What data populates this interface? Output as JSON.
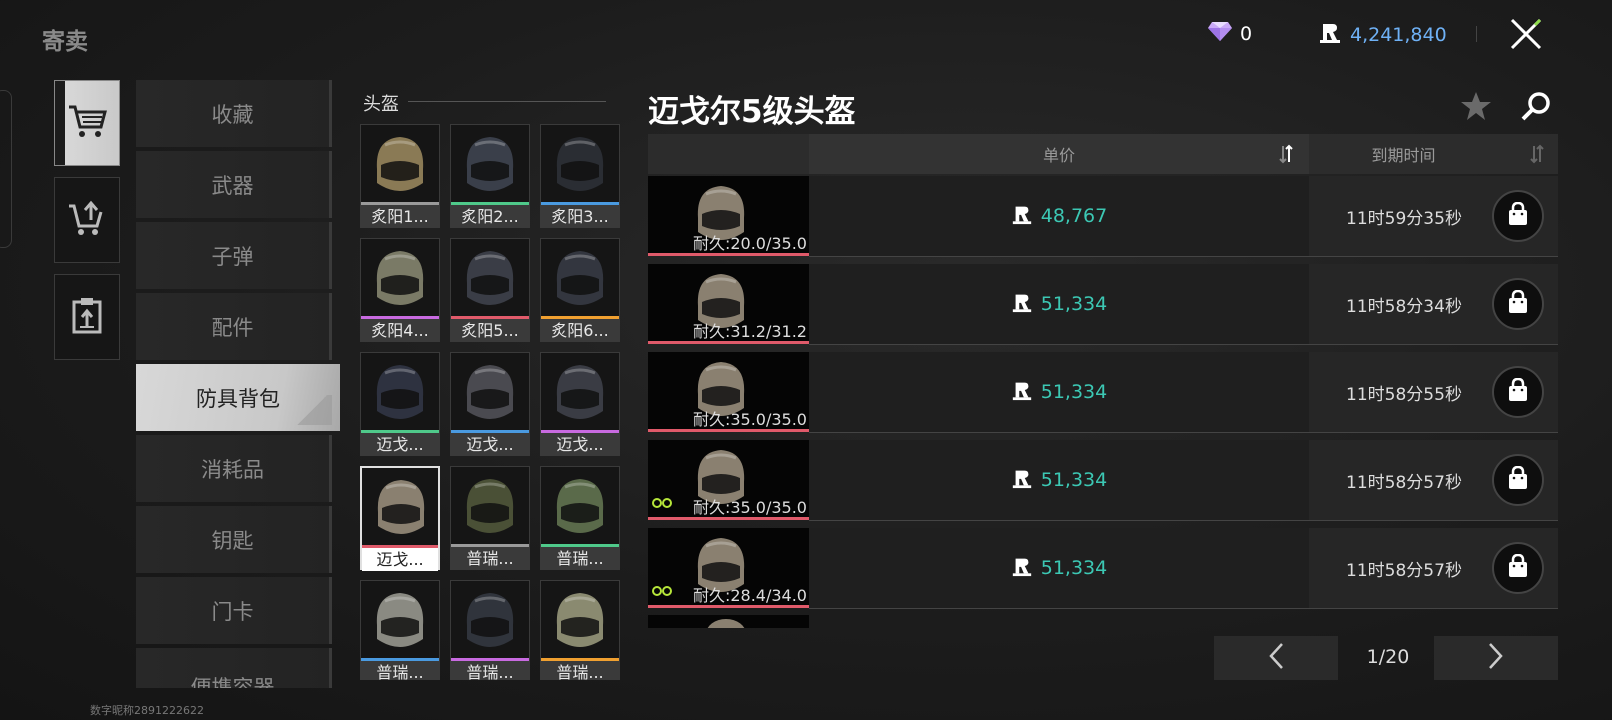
{
  "header": {
    "title": "寄卖",
    "gems": "0",
    "money": "4,241,840"
  },
  "sidebar": {
    "buttons": [
      {
        "icon": "cart-icon"
      },
      {
        "icon": "cart-upload-icon"
      },
      {
        "icon": "clipboard-icon"
      }
    ]
  },
  "categories": [
    {
      "label": "收藏"
    },
    {
      "label": "武器"
    },
    {
      "label": "子弹"
    },
    {
      "label": "配件"
    },
    {
      "label": "防具背包"
    },
    {
      "label": "消耗品"
    },
    {
      "label": "钥匙"
    },
    {
      "label": "门卡"
    },
    {
      "label": "便携容器"
    }
  ],
  "active_category": "防具背包",
  "section": {
    "title": "头盔"
  },
  "items": [
    {
      "label": "炙阳1...",
      "rarity": "#9a9a9a",
      "color": "#8a7a55"
    },
    {
      "label": "炙阳2...",
      "rarity": "#4fc98a",
      "color": "#3a3f4a"
    },
    {
      "label": "炙阳3...",
      "rarity": "#4a9ae0",
      "color": "#2a2d33"
    },
    {
      "label": "炙阳4...",
      "rarity": "#c86ae0",
      "color": "#7a7a66"
    },
    {
      "label": "炙阳5...",
      "rarity": "#e05a6a",
      "color": "#3a3d46"
    },
    {
      "label": "炙阳6...",
      "rarity": "#f0a030",
      "color": "#33363f"
    },
    {
      "label": "迈戈...",
      "rarity": "#4fc98a",
      "color": "#2e3240"
    },
    {
      "label": "迈戈...",
      "rarity": "#4a9ae0",
      "color": "#4a4a50"
    },
    {
      "label": "迈戈...",
      "rarity": "#c86ae0",
      "color": "#3a3c44"
    },
    {
      "label": "迈戈...",
      "rarity": "#e05a6a",
      "color": "#8a8070"
    },
    {
      "label": "普瑞...",
      "rarity": "#9a9a9a",
      "color": "#4a5036"
    },
    {
      "label": "普瑞...",
      "rarity": "#4fc98a",
      "color": "#5a6a4a"
    },
    {
      "label": "普瑞...",
      "rarity": "#4a9ae0",
      "color": "#8a8a82"
    },
    {
      "label": "普瑞...",
      "rarity": "#c86ae0",
      "color": "#30343c"
    },
    {
      "label": "普瑞...",
      "rarity": "#f0a030",
      "color": "#8a8a70"
    }
  ],
  "selected_index": 9,
  "detail": {
    "title": "迈戈尔5级头盔"
  },
  "table": {
    "col_price": "单价",
    "col_time": "到期时间"
  },
  "listings": [
    {
      "durability": "耐久:20.0/35.0",
      "price": "48,767",
      "time": "11时59分35秒",
      "goggles": false
    },
    {
      "durability": "耐久:31.2/31.2",
      "price": "51,334",
      "time": "11时58分34秒",
      "goggles": false
    },
    {
      "durability": "耐久:35.0/35.0",
      "price": "51,334",
      "time": "11时58分55秒",
      "goggles": false
    },
    {
      "durability": "耐久:35.0/35.0",
      "price": "51,334",
      "time": "11时58分57秒",
      "goggles": true
    },
    {
      "durability": "耐久:28.4/34.0",
      "price": "51,334",
      "time": "11时58分57秒",
      "goggles": true
    }
  ],
  "pagination": {
    "text": "1/20"
  },
  "footer": {
    "text": "数字昵称2891222622"
  },
  "colors": {
    "price": "#3cc8b4",
    "money": "#6fb1f5",
    "durability_bar": "#e05a6a"
  }
}
